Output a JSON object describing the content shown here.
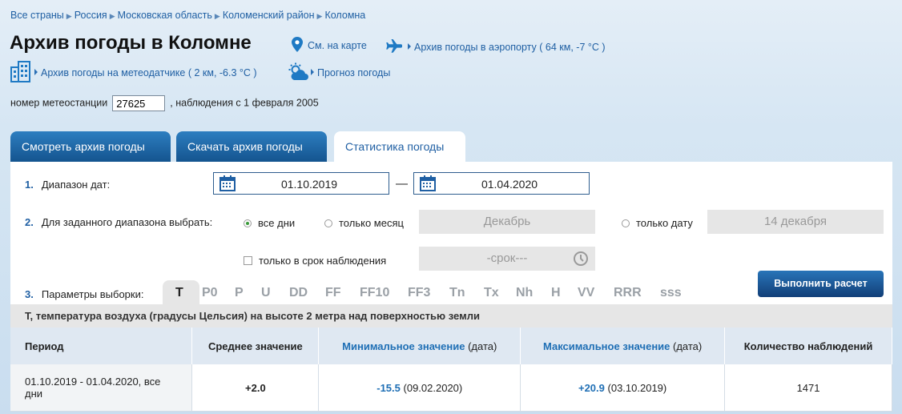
{
  "breadcrumbs": [
    "Все страны",
    "Россия",
    "Московская область",
    "Коломенский район",
    "Коломна"
  ],
  "page_title": "Архив погоды в Коломне",
  "header_links": {
    "map": "См. на карте",
    "airport": "Архив погоды в аэропорту ( 64 км, -7 °C )",
    "sensor": "Архив погоды на метеодатчике ( 2 км, -6.3 °C )",
    "forecast": "Прогноз погоды"
  },
  "station": {
    "label": "номер метеостанции",
    "value": "27625",
    "since": ", наблюдения с 1 февраля 2005"
  },
  "tabs": [
    {
      "label": "Смотреть архив погоды"
    },
    {
      "label": "Скачать архив погоды"
    },
    {
      "label": "Статистика погоды",
      "active": true
    }
  ],
  "form": {
    "step1": {
      "num": "1.",
      "label": "Диапазон дат:",
      "from": "01.10.2019",
      "dash": "—",
      "to": "01.04.2020"
    },
    "step2": {
      "num": "2.",
      "label": "Для заданного диапазона выбрать:",
      "all_days": "все дни",
      "only_month": "только месяц",
      "month_value": "Декабрь",
      "only_date": "только дату",
      "date_value": "14 декабря",
      "only_obs_time": "только в срок наблюдения",
      "time_value": "-срок---"
    },
    "step3": {
      "num": "3.",
      "label": "Параметры выборки:"
    },
    "params": [
      "T",
      "P0",
      "P",
      "U",
      "DD",
      "FF",
      "FF10",
      "FF3",
      "Tn",
      "Tx",
      "Nh",
      "H",
      "VV",
      "RRR",
      "sss"
    ],
    "active_param": "T",
    "run_button": "Выполнить расчет"
  },
  "description": "T, температура воздуха (градусы Цельсия) на высоте 2 метра над поверхностью земли",
  "table": {
    "headers": {
      "period": "Период",
      "avg": "Среднее значение",
      "min_label": "Минимальное значение",
      "min_suffix": "(дата)",
      "max_label": "Максимальное значение",
      "max_suffix": "(дата)",
      "count": "Количество наблюдений"
    },
    "row": {
      "period": "01.10.2019 - 01.04.2020, все дни",
      "avg": "+2.0",
      "min_value": "-15.5",
      "min_date": "(09.02.2020)",
      "max_value": "+20.9",
      "max_date": "(03.10.2019)",
      "count": "1471"
    }
  },
  "colors": {
    "accent": "#1f5fa3",
    "tab_dark": "#14548f",
    "panel_gray": "#e6e6e6"
  }
}
